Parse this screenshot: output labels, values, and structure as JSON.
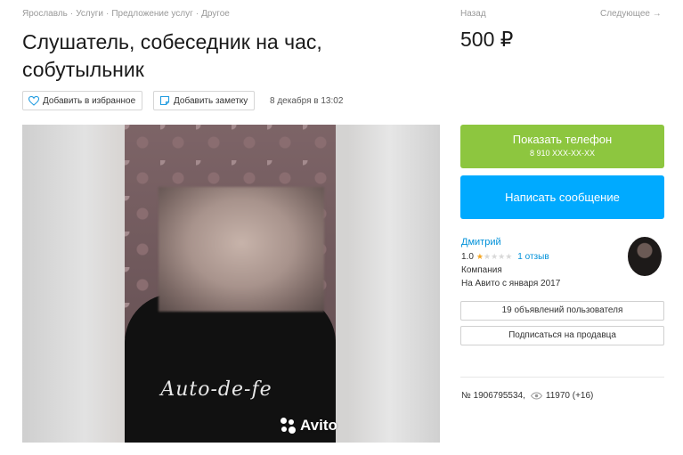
{
  "breadcrumb": [
    "Ярославль",
    "Услуги",
    "Предложение услуг",
    "Другое"
  ],
  "breadcrumb_sep": "·",
  "title": "Слушатель, собеседник на час, собутыльник",
  "actions": {
    "favorite_label": "Добавить в избранное",
    "note_label": "Добавить заметку",
    "date": "8 декабря в 13:02"
  },
  "nav": {
    "back": "Назад",
    "next": "Следующее →"
  },
  "price": "500 ₽",
  "photo": {
    "shirt_text": "Auto-de-fe",
    "watermark": "Avito"
  },
  "contact": {
    "phone_label": "Показать телефон",
    "phone_masked": "8 910 XXX-XX-XX",
    "message_label": "Написать сообщение"
  },
  "seller": {
    "name": "Дмитрий",
    "rating": "1.0",
    "rating_value": 1,
    "rating_max": 5,
    "reviews": "1 отзыв",
    "type": "Компания",
    "since": "На Авито с января 2017",
    "listings_button": "19 объявлений пользователя",
    "subscribe_button": "Подписаться на продавца"
  },
  "meta": {
    "ad_number": "№ 1906795534,",
    "views": "11970 (+16)"
  },
  "colors": {
    "green": "#8dc63f",
    "blue": "#00aaff",
    "link": "#0091d9",
    "star": "#f5a623"
  }
}
